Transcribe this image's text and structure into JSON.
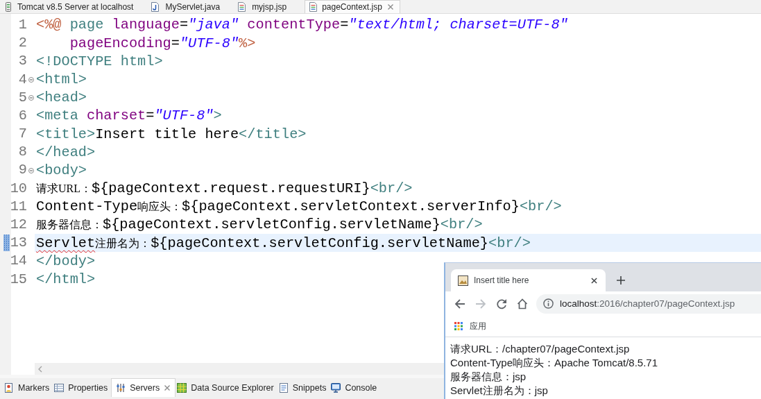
{
  "editor_tabs": [
    {
      "label": "Tomcat v8.5 Server at localhost",
      "kind": "server",
      "selected": false
    },
    {
      "label": "MyServlet.java",
      "kind": "java",
      "selected": false
    },
    {
      "label": "myjsp.jsp",
      "kind": "jsp",
      "selected": false
    },
    {
      "label": "pageContext.jsp",
      "kind": "jsp",
      "selected": true
    }
  ],
  "editor": {
    "lines": [
      {
        "number": "1",
        "fold": false,
        "current": false,
        "tokens": [
          {
            "text": "<%@",
            "kind": "jsp"
          },
          {
            "text": " page ",
            "kind": "directive"
          },
          {
            "text": "language",
            "kind": "attr"
          },
          {
            "text": "=",
            "kind": "op"
          },
          {
            "text": "\"java\"",
            "kind": "string"
          },
          {
            "text": " contentType",
            "kind": "attr"
          },
          {
            "text": "=",
            "kind": "op"
          },
          {
            "text": "\"text/html; charset=UTF-8\"",
            "kind": "string"
          }
        ]
      },
      {
        "number": "2",
        "fold": false,
        "current": false,
        "tokens": [
          {
            "text": "    pageEncoding",
            "kind": "attr"
          },
          {
            "text": "=",
            "kind": "op"
          },
          {
            "text": "\"UTF-8\"",
            "kind": "string"
          },
          {
            "text": "%>",
            "kind": "jsp"
          }
        ]
      },
      {
        "number": "3",
        "fold": false,
        "current": false,
        "tokens": [
          {
            "text": "<!DOCTYPE html>",
            "kind": "tag"
          }
        ]
      },
      {
        "number": "4",
        "fold": true,
        "current": false,
        "tokens": [
          {
            "text": "<html>",
            "kind": "tag"
          }
        ]
      },
      {
        "number": "5",
        "fold": true,
        "current": false,
        "tokens": [
          {
            "text": "<head>",
            "kind": "tag"
          }
        ]
      },
      {
        "number": "6",
        "fold": false,
        "current": false,
        "tokens": [
          {
            "text": "<meta ",
            "kind": "tag"
          },
          {
            "text": "charset",
            "kind": "attr"
          },
          {
            "text": "=",
            "kind": "op"
          },
          {
            "text": "\"UTF-8\"",
            "kind": "string"
          },
          {
            "text": ">",
            "kind": "tag"
          }
        ]
      },
      {
        "number": "7",
        "fold": false,
        "current": false,
        "tokens": [
          {
            "text": "<title>",
            "kind": "tag"
          },
          {
            "text": "Insert title here",
            "kind": "text"
          },
          {
            "text": "</title>",
            "kind": "tag"
          }
        ]
      },
      {
        "number": "8",
        "fold": false,
        "current": false,
        "tokens": [
          {
            "text": "</head>",
            "kind": "tag"
          }
        ]
      },
      {
        "number": "9",
        "fold": true,
        "current": false,
        "tokens": [
          {
            "text": "<body>",
            "kind": "tag"
          }
        ]
      },
      {
        "number": "10",
        "fold": false,
        "current": false,
        "tokens": [
          {
            "text": "请求URL：",
            "kind": "cjk"
          },
          {
            "text": "${pageContext.request.requestURI}",
            "kind": "text"
          },
          {
            "text": "<br/>",
            "kind": "tag"
          }
        ]
      },
      {
        "number": "11",
        "fold": false,
        "current": false,
        "tokens": [
          {
            "text": "Content-Type",
            "kind": "text"
          },
          {
            "text": "响应头：",
            "kind": "cjk"
          },
          {
            "text": "${pageContext.servletContext.serverInfo}",
            "kind": "text"
          },
          {
            "text": "<br/>",
            "kind": "tag"
          }
        ]
      },
      {
        "number": "12",
        "fold": false,
        "current": false,
        "tokens": [
          {
            "text": "服务器信息：",
            "kind": "cjk"
          },
          {
            "text": "${pageContext.servletConfig.servletName}",
            "kind": "text"
          },
          {
            "text": "<br/>",
            "kind": "tag"
          }
        ]
      },
      {
        "number": "13",
        "fold": false,
        "current": true,
        "tokens": [
          {
            "text": "Servlet",
            "kind": "misspelled"
          },
          {
            "text": "注册名为：",
            "kind": "cjk"
          },
          {
            "text": "${pageContext.servletConfig.servletName}",
            "kind": "text"
          },
          {
            "text": "<br/>",
            "kind": "tag"
          }
        ]
      },
      {
        "number": "14",
        "fold": false,
        "current": false,
        "tokens": [
          {
            "text": "</body>",
            "kind": "tag"
          }
        ]
      },
      {
        "number": "15",
        "fold": false,
        "current": false,
        "tokens": [
          {
            "text": "</html>",
            "kind": "tag"
          }
        ]
      }
    ]
  },
  "panel_tabs": [
    {
      "label": "Markers",
      "kind": "markers",
      "selected": false
    },
    {
      "label": "Properties",
      "kind": "properties",
      "selected": false
    },
    {
      "label": "Servers",
      "kind": "servers",
      "selected": true
    },
    {
      "label": "Data Source Explorer",
      "kind": "datasource",
      "selected": false
    },
    {
      "label": "Snippets",
      "kind": "snippets",
      "selected": false
    },
    {
      "label": "Console",
      "kind": "console",
      "selected": false
    }
  ],
  "browser": {
    "tab": {
      "title": "Insert title here"
    },
    "nav": [
      {
        "kind": "back",
        "disabled": false
      },
      {
        "kind": "forward",
        "disabled": true
      },
      {
        "kind": "reload",
        "disabled": false
      },
      {
        "kind": "home",
        "disabled": false
      }
    ],
    "address": {
      "host": "localhost",
      "path": ":2016/chapter07/pageContext.jsp"
    },
    "bookmarks": [
      {
        "label": "应用",
        "kind": "apps"
      }
    ],
    "content": [
      "请求URL：/chapter07/pageContext.jsp",
      "Content-Type响应头：Apache Tomcat/8.5.71",
      "服务器信息：jsp",
      "Servlet注册名为：jsp"
    ]
  }
}
